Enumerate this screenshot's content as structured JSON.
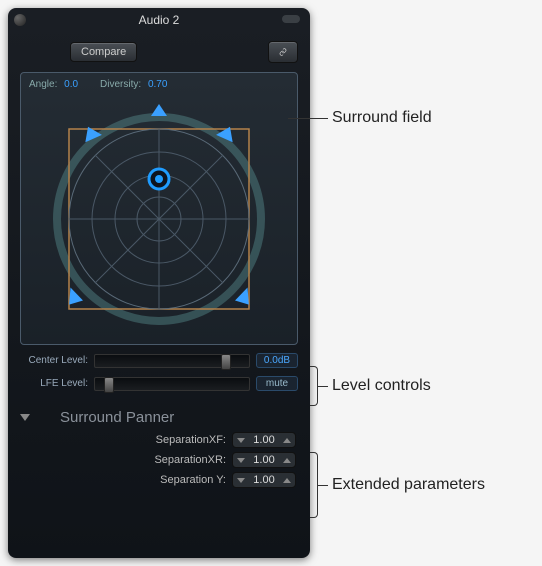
{
  "window": {
    "title": "Audio 2"
  },
  "toolbar": {
    "compare": "Compare"
  },
  "surround": {
    "angle_label": "Angle:",
    "angle_value": "0.0",
    "diversity_label": "Diversity:",
    "diversity_value": "0.70"
  },
  "levels": {
    "center_label": "Center Level:",
    "center_value": "0.0dB",
    "center_slider_pos": 0.82,
    "lfe_label": "LFE Level:",
    "lfe_mute": "mute",
    "lfe_slider_pos": 0.06
  },
  "section": {
    "title": "Surround Panner"
  },
  "params": [
    {
      "label": "SeparationXF:",
      "value": "1.00"
    },
    {
      "label": "SeparationXR:",
      "value": "1.00"
    },
    {
      "label": "Separation Y:",
      "value": "1.00"
    }
  ],
  "callouts": {
    "field": "Surround field",
    "levels": "Level controls",
    "extended": "Extended parameters"
  },
  "colors": {
    "accent_blue": "#1f9cff",
    "speaker_arrow": "#3aa0ff",
    "square": "#b4824a"
  }
}
